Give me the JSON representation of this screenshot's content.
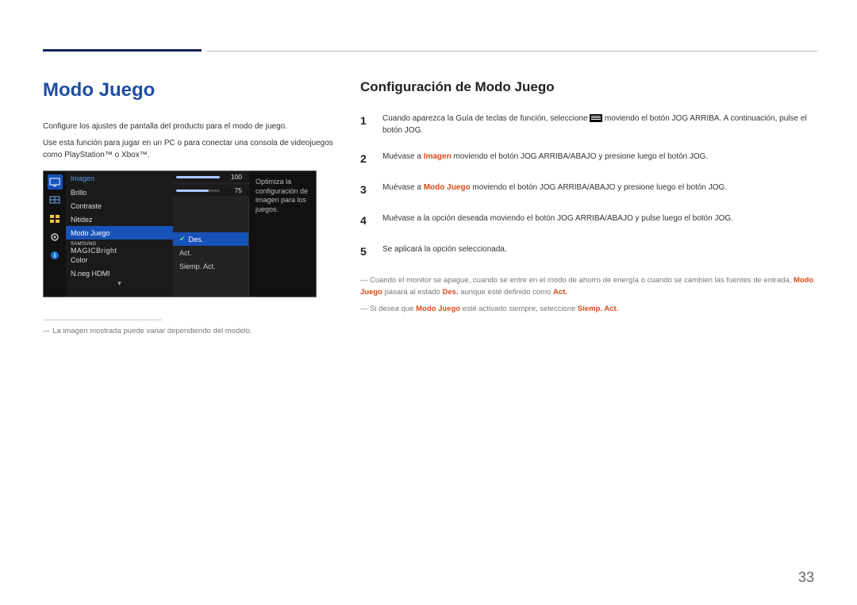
{
  "page_number": "33",
  "heading": "Modo Juego",
  "para1": "Configure los ajustes de pantalla del producto para el modo de juego.",
  "para2": "Use esta función para jugar en un PC o para conectar una consola de videojuegos como PlayStation™ o Xbox™.",
  "footnote": "La imagen mostrada puede variar dependiendo del modelo.",
  "osd": {
    "header": "Imagen",
    "items": {
      "brillo": {
        "label": "Brillo",
        "value": "100",
        "fill": 100
      },
      "contraste": {
        "label": "Contraste",
        "value": "75",
        "fill": 75
      },
      "nitidez": {
        "label": "Nitidez"
      },
      "modojuego": {
        "label": "Modo Juego"
      },
      "magic": {
        "label_pre": "SAMSUNG",
        "label": "MAGICBright"
      },
      "color": {
        "label": "Color"
      },
      "nneg": {
        "label": "N.neg HDMI"
      }
    },
    "popup": {
      "des": "Des.",
      "act": "Act.",
      "siemp": "Siemp. Act."
    },
    "desc": "Optimiza la configuración de imagen para los juegos."
  },
  "sub_heading": "Configuración de Modo Juego",
  "steps": {
    "s1a": "Cuando aparezca la Guía de teclas de función, seleccione ",
    "s1b": " moviendo el botón JOG ARRIBA. A continuación, pulse el botón JOG.",
    "s2a": "Muévase a ",
    "s2b": " moviendo el botón JOG ARRIBA/ABAJO y presione luego el botón JOG.",
    "s3a": "Muévase a ",
    "s3b": " moviendo el botón JOG ARRIBA/ABAJO y presione luego el botón JOG.",
    "s4": "Muévase a la opción deseada moviendo el botón JOG ARRIBA/ABAJO y pulse luego el botón JOG.",
    "s5": "Se aplicará la opción seleccionada."
  },
  "notes": {
    "n1a": "Cuando el monitor se apague, cuando se entre en el modo de ahorro de energía o cuando se cambien las fuentes de entrada, ",
    "n1b": " pasará al estado ",
    "n1c": " aunque esté definido como ",
    "n2a": "Si desea que ",
    "n2b": " esté activado siempre, seleccione "
  },
  "keywords": {
    "imagen": "Imagen",
    "modojuego": "Modo Juego",
    "des": "Des.",
    "act": "Act.",
    "siemp": "Siemp. Act."
  }
}
